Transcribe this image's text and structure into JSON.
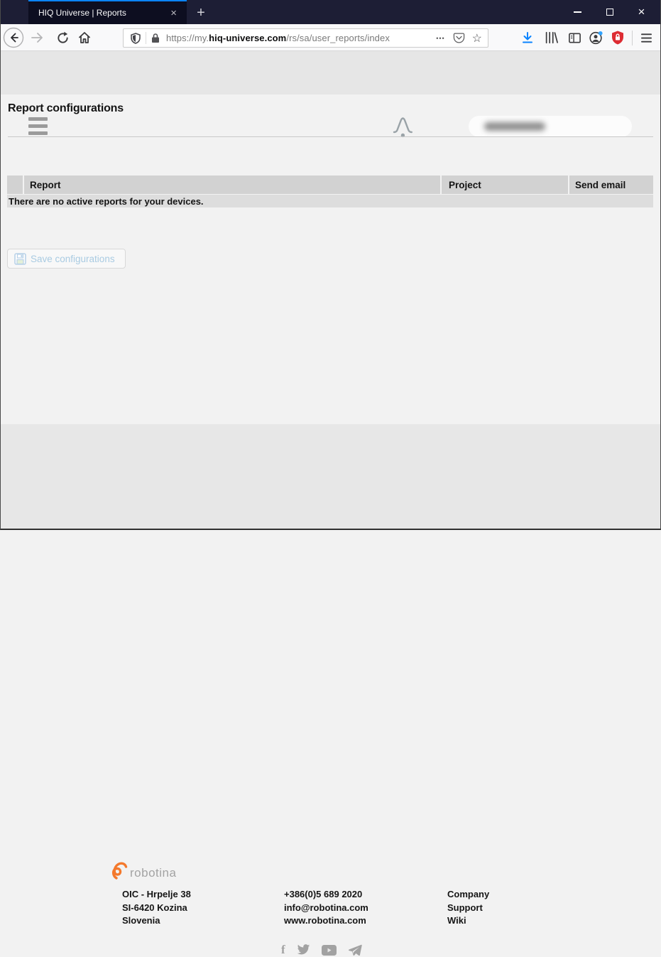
{
  "browser": {
    "tab_title": "HIQ Universe | Reports",
    "url": {
      "scheme_prefix": "https://my.",
      "domain": "hiq-universe.com",
      "path": "/rs/sa/user_reports/index"
    }
  },
  "icons": {
    "close": "×",
    "plus": "+",
    "ellipsis": "•••",
    "star": "☆"
  },
  "page": {
    "title": "Report configurations",
    "table": {
      "columns": {
        "select": "",
        "report": "Report",
        "project": "Project",
        "send_email": "Send email"
      },
      "empty_message": "There are no active reports for your devices."
    },
    "save_button_label": "Save configurations"
  },
  "footer": {
    "brand": "robotina",
    "address_lines": [
      "OIC - Hrpelje 38",
      "SI-6420 Kozina",
      "Slovenia"
    ],
    "contact_lines": [
      "+386(0)5 689 2020",
      "info@robotina.com",
      "www.robotina.com"
    ],
    "links": [
      "Company",
      "Support",
      "Wiki"
    ]
  },
  "colors": {
    "titlebar": "#1d1e35",
    "tab_accent_blue": "#0a84ff",
    "download_blue": "#0a84ff",
    "extension_shield_red": "#dd2c33",
    "brand_orange": "#f4792c",
    "save_button_text": "#a9cbe2",
    "table_header_bg": "#d2d2d2",
    "footer_bg": "#e7e7e7"
  }
}
